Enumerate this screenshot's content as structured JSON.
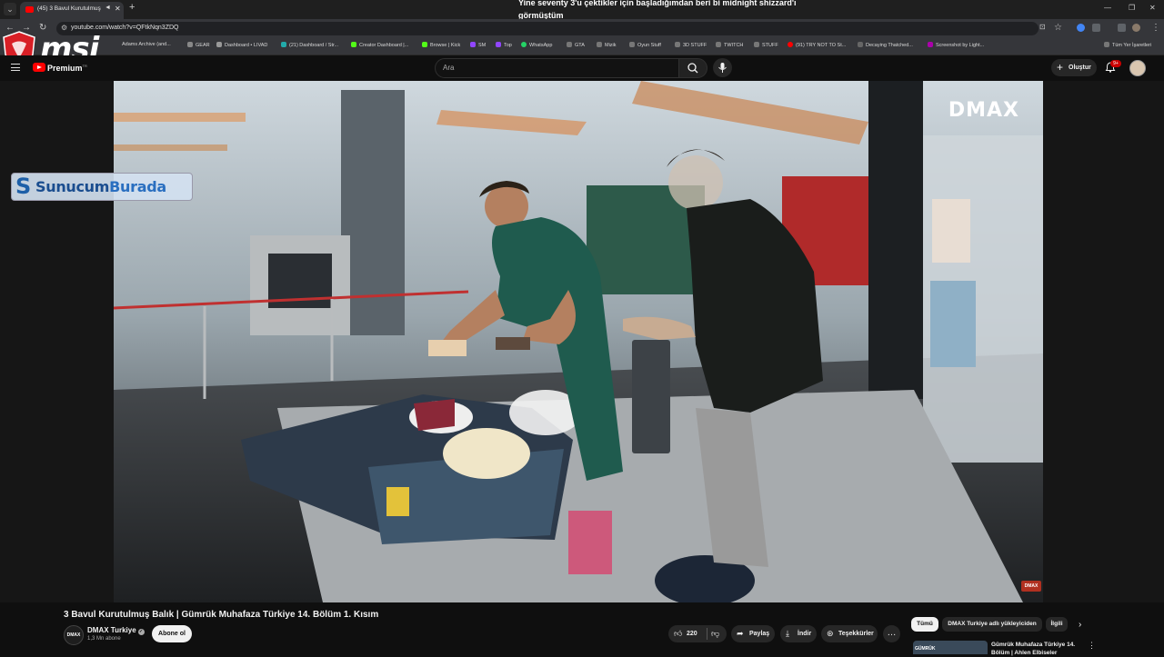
{
  "browser": {
    "tab_title": "(45) 3 Bavul Kurutulmuş Bal...",
    "overlay_line1": "Yine seventy 3'u çektikler için başladığımdan beri bi midnight shizzard'ı",
    "overlay_line2": "görmüştüm",
    "url": "youtube.com/watch?v=QFtkNqn3ZDQ",
    "bookmarks": [
      {
        "label": "Adams Archive (and..."
      },
      {
        "label": "GEAR"
      },
      {
        "label": "Dashboard • LIVAD"
      },
      {
        "label": "(21) Dashboard / Str..."
      },
      {
        "label": "Creator Dashboard |..."
      },
      {
        "label": "Browse | Kick"
      },
      {
        "label": "SM"
      },
      {
        "label": "Top"
      },
      {
        "label": "WhatsApp"
      },
      {
        "label": "GTA"
      },
      {
        "label": "Mizik"
      },
      {
        "label": "Oyun Stuff"
      },
      {
        "label": "3D STUFF"
      },
      {
        "label": "TWITCH"
      },
      {
        "label": "STUFF"
      },
      {
        "label": "(91) TRY NOT TO St..."
      },
      {
        "label": "Decaying Thatched..."
      },
      {
        "label": "Screenshot by Light..."
      }
    ],
    "all_bookmarks": "Tüm Yer İşaretleri",
    "accent": "#ff0000"
  },
  "overlay_logo": {
    "brand": "msi",
    "brand_color": "#d81f26"
  },
  "youtube": {
    "premium_label": "Premium",
    "premium_region": "TR",
    "search_placeholder": "Ara",
    "create_label": "Oluştur",
    "notif_badge": "9+"
  },
  "video": {
    "channel_watermark": "DMAX",
    "sponsor_prefix": "Sunucum",
    "sponsor_suffix": "Burada",
    "corner_logo": "DMAX",
    "title": "3 Bavul Kurutulmuş Balık | Gümrük Muhafaza Türkiye 14. Bölüm 1. Kısım"
  },
  "channel": {
    "avatar_text": "DMAX",
    "name": "DMAX Turkiye",
    "subscribers": "1,3 Mn abone",
    "subscribe_label": "Abone ol"
  },
  "actions": {
    "likes": "220",
    "share": "Paylaş",
    "download": "İndir",
    "thanks": "Teşekkürler"
  },
  "related": {
    "chips": [
      "Tümü",
      "DMAX Turkiye adlı yükleyiciden",
      "İlgili"
    ],
    "first_title": "Gümrük Muhafaza Türkiye 14. Bölüm | Ahlen Elbiseler",
    "first_thumb_text": "GÜMRÜK"
  }
}
